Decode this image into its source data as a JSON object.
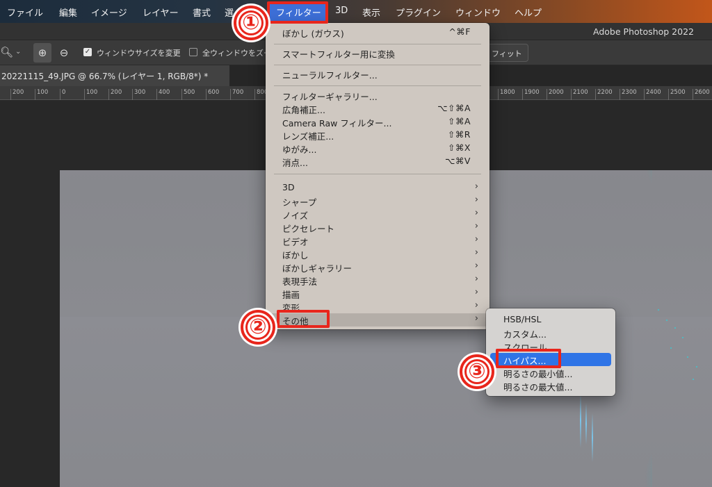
{
  "menubar": {
    "items": [
      "ファイル",
      "編集",
      "イメージ",
      "レイヤー",
      "書式",
      "選",
      "フィルター",
      "3D",
      "表示",
      "プラグイン",
      "ウィンドウ",
      "ヘルプ"
    ]
  },
  "app_title": "Adobe Photoshop 2022",
  "options_bar": {
    "resize_windows_label": "ウィンドウサイズを変更",
    "all_windows_label": "全ウィンドウをズー",
    "fit_label": "フィット"
  },
  "document_tab": "20221115_49.JPG @ 66.7% (レイヤー 1, RGB/8*) *",
  "ruler_ticks": [
    "200",
    "100",
    "0",
    "100",
    "200",
    "300",
    "400",
    "500",
    "600",
    "700",
    "800",
    "1800",
    "1900",
    "2000",
    "2100",
    "2200",
    "2300",
    "2400",
    "2500",
    "2600"
  ],
  "filter_menu": {
    "gaussian_blur": "ぼかし (ガウス)",
    "gaussian_blur_shortcut": "^⌘F",
    "smart_filter": "スマートフィルター用に変換",
    "neural_filter": "ニューラルフィルター...",
    "filter_gallery": "フィルターギャラリー...",
    "adaptive_wide_angle": "広角補正...",
    "adaptive_wide_angle_shortcut": "⌥⇧⌘A",
    "camera_raw": "Camera Raw フィルター...",
    "camera_raw_shortcut": "⇧⌘A",
    "lens_correction": "レンズ補正...",
    "lens_correction_shortcut": "⇧⌘R",
    "liquify": "ゆがみ...",
    "liquify_shortcut": "⇧⌘X",
    "vanishing_point": "消点...",
    "vanishing_point_shortcut": "⌥⌘V",
    "submenus": [
      "3D",
      "シャープ",
      "ノイズ",
      "ピクセレート",
      "ビデオ",
      "ぼかし",
      "ぼかしギャラリー",
      "表現手法",
      "描画",
      "変形",
      "その他"
    ]
  },
  "other_submenu": {
    "items": [
      "HSB/HSL",
      "カスタム...",
      "スクロール...",
      "ハイパス...",
      "明るさの最小値...",
      "明るさの最大値..."
    ]
  },
  "annotations": {
    "step1": "①",
    "step2": "②",
    "step3": "③",
    "color": "#e8261c"
  },
  "colors": {
    "menu_bg": "#cfc8c1",
    "selection": "#2f74e6"
  }
}
